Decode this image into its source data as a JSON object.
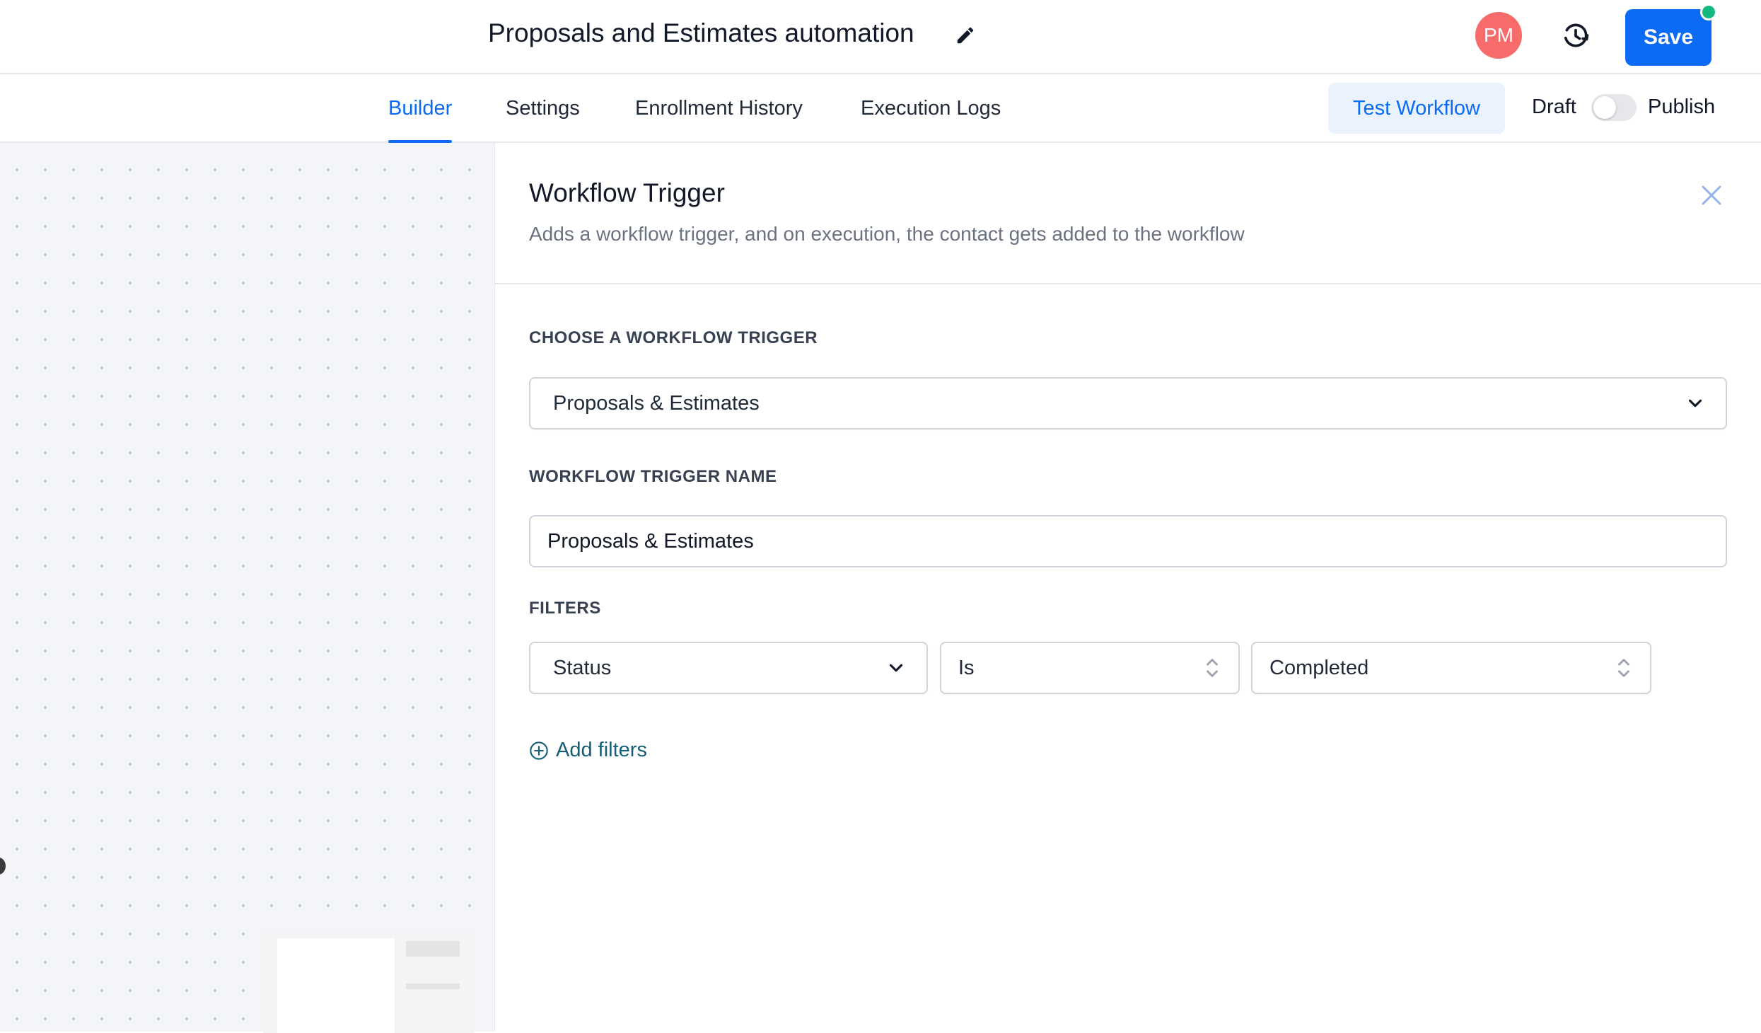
{
  "header": {
    "title": "Proposals and Estimates automation",
    "edit_icon": "pencil-icon",
    "avatar_initials": "PM",
    "avatar_color": "#f76b6b",
    "history_icon": "history-icon",
    "save_label": "Save",
    "save_color": "#0b6bf5",
    "status_dot_color": "#12b981"
  },
  "tabs": [
    {
      "label": "Builder",
      "active": true
    },
    {
      "label": "Settings",
      "active": false
    },
    {
      "label": "Enrollment History",
      "active": false
    },
    {
      "label": "Execution Logs",
      "active": false
    }
  ],
  "toolbar": {
    "test_label": "Test Workflow",
    "draft_label": "Draft",
    "publish_label": "Publish",
    "publish_toggle_on": false
  },
  "panel": {
    "title": "Workflow Trigger",
    "subtitle": "Adds a workflow trigger, and on execution, the contact gets added to the workflow",
    "close_icon": "close-icon",
    "trigger_label": "CHOOSE A WORKFLOW TRIGGER",
    "trigger_value": "Proposals & Estimates",
    "name_label": "WORKFLOW TRIGGER NAME",
    "name_value": "Proposals & Estimates",
    "filters_label": "FILTERS",
    "filters": [
      {
        "field": "Status",
        "operator": "Is",
        "value": "Completed"
      }
    ],
    "add_filters_label": "Add filters",
    "add_filters_icon": "plus-circle-icon"
  }
}
